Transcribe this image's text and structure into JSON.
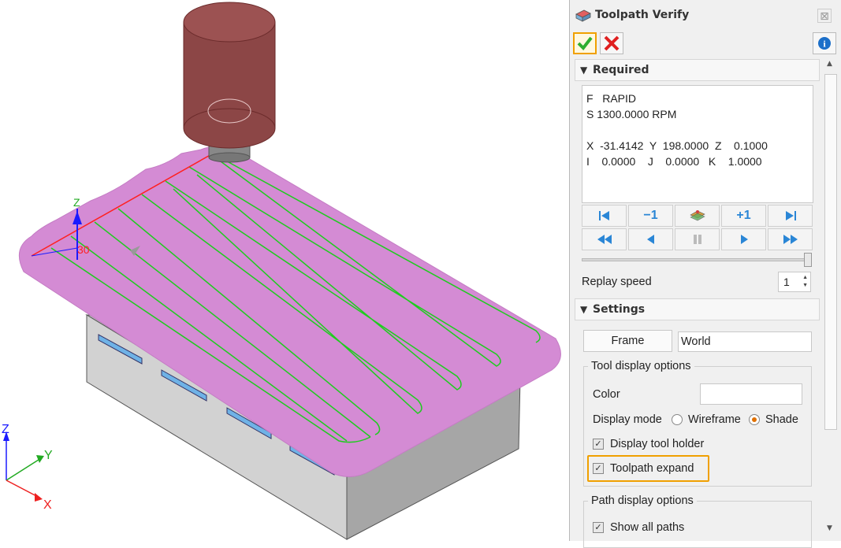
{
  "window": {
    "title": "Toolpath Verify"
  },
  "toolbar": {
    "ok_icon": "check-icon",
    "cancel_icon": "x-icon",
    "info_icon": "info-icon"
  },
  "required": {
    "header": "Required",
    "readout": {
      "f_line": "F   RAPID",
      "s_line": "S 1300.0000 RPM",
      "xyz_line": "X  -31.4142  Y  198.0000  Z    0.1000",
      "ijk_line": "I    0.0000    J    0.0000   K    1.0000"
    },
    "controls_row1": [
      "|◀",
      "−1",
      "tool-icon",
      "+1",
      "▶|"
    ],
    "controls_row2": [
      "◀◀",
      "◀",
      "❚❚",
      "▶",
      "▶▶"
    ],
    "slider_position": 1.0,
    "replay_speed_label": "Replay speed",
    "replay_speed_value": "1"
  },
  "settings": {
    "header": "Settings",
    "frame_button": "Frame",
    "frame_value": "World",
    "tool_display": {
      "legend": "Tool display options",
      "color_label": "Color",
      "display_mode_label": "Display mode",
      "wireframe_label": "Wireframe",
      "shade_label": "Shade",
      "selected_mode": "Shade",
      "display_tool_holder_label": "Display tool holder",
      "display_tool_holder_checked": true,
      "toolpath_expand_label": "Toolpath expand",
      "toolpath_expand_checked": true
    },
    "path_display": {
      "legend": "Path display options",
      "show_all_paths_label": "Show all paths",
      "show_all_paths_checked": true
    }
  },
  "viewport": {
    "axis_labels": {
      "z": "Z",
      "y": "Y",
      "x": "X"
    },
    "dimension_label": "30",
    "colors": {
      "stock_top": "#d888d8",
      "toolpath": "#22cc22",
      "tool_body": "#8a3f3f",
      "base_side": "#c8c8c8",
      "slots": "#5aa8e0"
    }
  }
}
